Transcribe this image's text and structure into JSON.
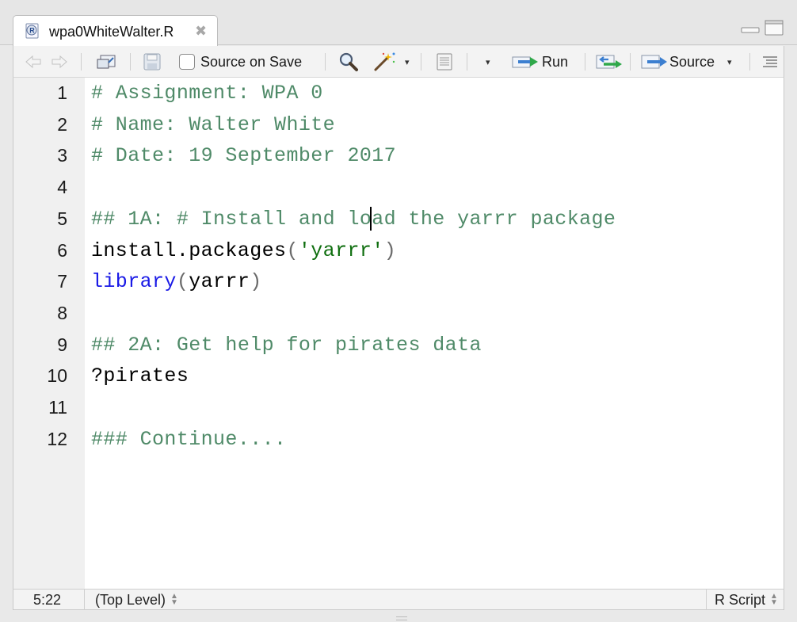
{
  "tab": {
    "title": "wpa0WhiteWalter.R",
    "close_glyph": "✖",
    "icon": "r-file-icon"
  },
  "toolbar": {
    "source_on_save_label": "Source on Save",
    "run_label": "Run",
    "source_label": "Source",
    "caret": "▾"
  },
  "editor": {
    "lines": [
      {
        "num": "1",
        "text": "# Assignment: WPA 0"
      },
      {
        "num": "2",
        "text": "# Name: Walter White"
      },
      {
        "num": "3",
        "text": "# Date: 19 September 2017"
      },
      {
        "num": "4",
        "text": ""
      },
      {
        "num": "5",
        "text": "## 1A: # Install and load the yarrr package"
      },
      {
        "num": "6",
        "parts": [
          "install.packages",
          "(",
          "'yarrr'",
          ")"
        ]
      },
      {
        "num": "7",
        "parts": [
          "library",
          "(",
          "yarrr",
          ")"
        ]
      },
      {
        "num": "8",
        "text": ""
      },
      {
        "num": "9",
        "text": "## 2A: Get help for pirates data"
      },
      {
        "num": "10",
        "text": "?pirates"
      },
      {
        "num": "11",
        "text": ""
      },
      {
        "num": "12",
        "text": "### Continue...."
      }
    ]
  },
  "statusbar": {
    "position": "5:22",
    "scope": "(Top Level)",
    "file_type": "R Script"
  },
  "colors": {
    "comment": "#4f8a68",
    "function": "#1a1ae6",
    "string": "#0f6e0f"
  }
}
